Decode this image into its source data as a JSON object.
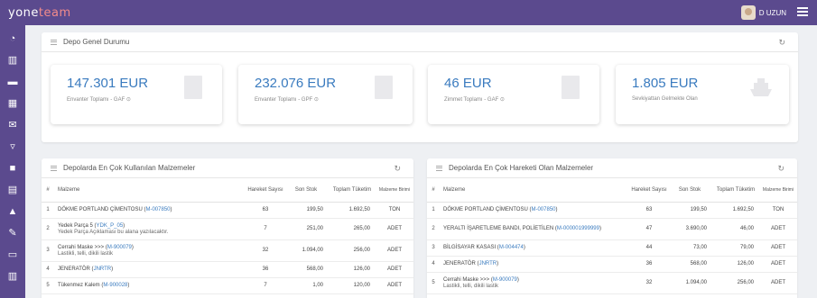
{
  "brand": {
    "prefix": "yone",
    "suffix": "team"
  },
  "user": {
    "name": "D UZUN"
  },
  "sidebar": {
    "icons": [
      "dashboard-icon",
      "chart-icon",
      "folder-icon",
      "calculator-icon",
      "mail-icon",
      "cart-icon",
      "truck-icon",
      "document-icon",
      "ship-icon",
      "wrench-icon",
      "inbox-icon",
      "bar-chart-icon",
      "settings-icon"
    ]
  },
  "status_panel": {
    "title": "Depo Genel Durumu",
    "cards": [
      {
        "amount": "147.301 EUR",
        "label": "Envanter Toplamı - GAF ⊙"
      },
      {
        "amount": "232.076 EUR",
        "label": "Envanter Toplamı - GPF ⊙"
      },
      {
        "amount": "46 EUR",
        "label": "Zimmet Toplamı - GAF ⊙"
      },
      {
        "amount": "1.805 EUR",
        "label": "Sevkiyattan Gelmekte Olan"
      }
    ]
  },
  "left_table": {
    "title": "Depolarda En Çok Kullanılan Malzemeler",
    "headers": {
      "idx": "#",
      "name": "Malzeme",
      "moves": "Hareket Sayısı",
      "stock": "Son Stok",
      "total": "Toplam Tüketim",
      "unit": "Malzeme Birimi"
    },
    "rows": [
      {
        "idx": "1",
        "name": "DÖKME PORTLAND ÇİMENTOSU (",
        "code": "M-007850",
        "close": ")",
        "sub": "",
        "moves": "63",
        "stock": "199,50",
        "total": "1.692,50",
        "unit": "TON"
      },
      {
        "idx": "2",
        "name": "Yedek Parça 5 (",
        "code": "YDK_P_05",
        "close": ")",
        "sub": "Yedek Parça Açıklaması bu alana yazılacaktır.",
        "moves": "7",
        "stock": "251,00",
        "total": "265,00",
        "unit": "ADET"
      },
      {
        "idx": "3",
        "name": "Cerrahi Maske >>> (",
        "code": "M-900079",
        "close": ")",
        "sub": "Lastikli, telli, dikili lastik",
        "moves": "32",
        "stock": "1.094,00",
        "total": "256,00",
        "unit": "ADET"
      },
      {
        "idx": "4",
        "name": "JENERATÖR (",
        "code": "JNRTR",
        "close": ")",
        "sub": "",
        "moves": "36",
        "stock": "568,00",
        "total": "126,00",
        "unit": "ADET"
      },
      {
        "idx": "5",
        "name": "Tükenmez Kalem (",
        "code": "M-900028",
        "close": ")",
        "sub": "",
        "moves": "7",
        "stock": "1,00",
        "total": "120,00",
        "unit": "ADET"
      }
    ]
  },
  "right_table": {
    "title": "Depolarda En Çok Hareketi Olan Malzemeler",
    "headers": {
      "idx": "#",
      "name": "Malzeme",
      "moves": "Hareket Sayısı",
      "stock": "Son Stok",
      "total": "Toplam Tüketim",
      "unit": "Malzeme Birimi"
    },
    "rows": [
      {
        "idx": "1",
        "name": "DÖKME PORTLAND ÇİMENTOSU (",
        "code": "M-007850",
        "close": ")",
        "sub": "",
        "moves": "63",
        "stock": "199,50",
        "total": "1.692,50",
        "unit": "TON"
      },
      {
        "idx": "2",
        "name": "YERALTI İŞARETLEME BANDI, POLİETİLEN (",
        "code": "M-000001999999",
        "close": ")",
        "sub": "",
        "moves": "47",
        "stock": "3.690,00",
        "total": "46,00",
        "unit": "ADET"
      },
      {
        "idx": "3",
        "name": "BİLGİSAYAR KASASI (",
        "code": "M-004474",
        "close": ")",
        "sub": "",
        "moves": "44",
        "stock": "73,00",
        "total": "79,00",
        "unit": "ADET"
      },
      {
        "idx": "4",
        "name": "JENERATÖR (",
        "code": "JNRTR",
        "close": ")",
        "sub": "",
        "moves": "36",
        "stock": "568,00",
        "total": "126,00",
        "unit": "ADET"
      },
      {
        "idx": "5",
        "name": "Cerrahi Maske >>> (",
        "code": "M-900079",
        "close": ")",
        "sub": "Lastikli, telli, dikili lastik",
        "moves": "32",
        "stock": "1.094,00",
        "total": "256,00",
        "unit": "ADET"
      }
    ]
  }
}
